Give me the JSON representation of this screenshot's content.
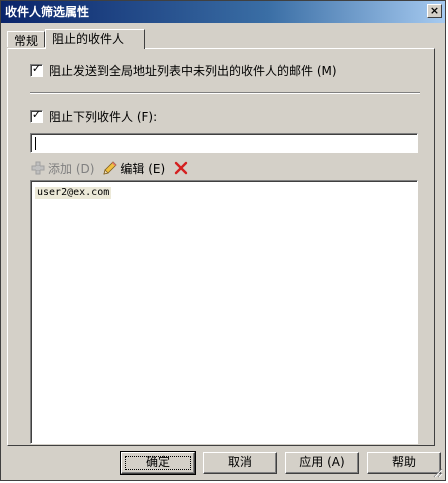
{
  "window": {
    "title": "收件人筛选属性",
    "close_glyph": "×"
  },
  "tabs": [
    {
      "label": "常规",
      "active": false
    },
    {
      "label": "阻止的收件人",
      "active": true
    }
  ],
  "options": {
    "block_unlisted": {
      "label": "阻止发送到全局地址列表中未列出的收件人的邮件 (M)",
      "checked": true
    },
    "block_list": {
      "label": "阻止下列收件人 (F):",
      "checked": true
    }
  },
  "recipient_input": {
    "value": "",
    "placeholder": ""
  },
  "toolbar": {
    "add_label": "添加 (D)",
    "add_enabled": false,
    "add_icon": "plus-icon",
    "edit_label": "编辑 (E)",
    "edit_icon": "pencil-icon",
    "delete_icon": "delete-x-icon"
  },
  "recipients": [
    "user2@ex.com"
  ],
  "buttons": {
    "ok": "确定",
    "cancel": "取消",
    "apply": "应用 (A)",
    "help": "帮助"
  },
  "colors": {
    "face": "#d4d0c8",
    "title_start": "#0a246a",
    "title_end": "#a6caf0",
    "delete": "#d42020"
  }
}
